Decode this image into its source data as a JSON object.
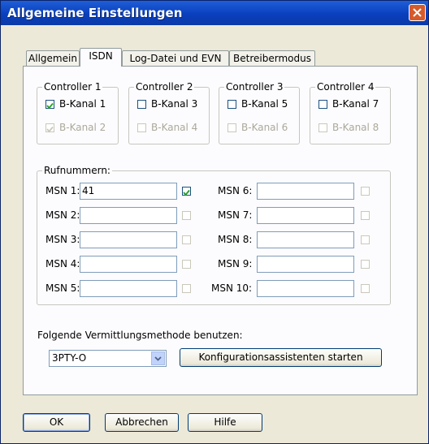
{
  "window": {
    "title": "Allgemeine Einstellungen"
  },
  "tabs": [
    {
      "label": "Allgemein"
    },
    {
      "label": "ISDN"
    },
    {
      "label": "Log-Datei und EVN"
    },
    {
      "label": "Betreibermodus"
    }
  ],
  "controllers": [
    {
      "name": "Controller 1",
      "ch1": "B-Kanal 1",
      "ch2": "B-Kanal 2",
      "ch1_checked": true,
      "ch2_checked": true
    },
    {
      "name": "Controller 2",
      "ch1": "B-Kanal 3",
      "ch2": "B-Kanal 4",
      "ch1_checked": false,
      "ch2_checked": false
    },
    {
      "name": "Controller 3",
      "ch1": "B-Kanal 5",
      "ch2": "B-Kanal 6",
      "ch1_checked": false,
      "ch2_checked": false
    },
    {
      "name": "Controller 4",
      "ch1": "B-Kanal 7",
      "ch2": "B-Kanal 8",
      "ch1_checked": false,
      "ch2_checked": false
    }
  ],
  "rufnummern": {
    "title": "Rufnummern:",
    "msn": [
      {
        "label": "MSN 1:",
        "value": "41",
        "checked": true
      },
      {
        "label": "MSN 2:",
        "value": "",
        "checked": false
      },
      {
        "label": "MSN 3:",
        "value": "",
        "checked": false
      },
      {
        "label": "MSN 4:",
        "value": "",
        "checked": false
      },
      {
        "label": "MSN 5:",
        "value": "",
        "checked": false
      },
      {
        "label": "MSN 6:",
        "value": "",
        "checked": false
      },
      {
        "label": "MSN 7:",
        "value": "",
        "checked": false
      },
      {
        "label": "MSN 8:",
        "value": "",
        "checked": false
      },
      {
        "label": "MSN 9:",
        "value": "",
        "checked": false
      },
      {
        "label": "MSN 10:",
        "value": "",
        "checked": false
      }
    ]
  },
  "method": {
    "label": "Folgende Vermittlungsmethode benutzen:",
    "selected": "3PTY-O",
    "assistant_button": "Konfigurationsassistenten starten"
  },
  "buttons": {
    "ok": "OK",
    "cancel": "Abbrechen",
    "help": "Hilfe"
  }
}
